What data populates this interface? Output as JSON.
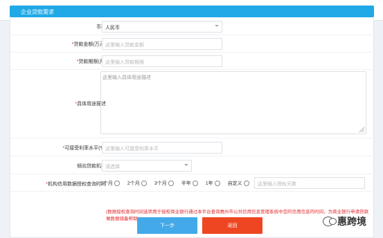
{
  "header": {
    "title": "企业贷款需求"
  },
  "form": {
    "currency": {
      "label": "币种",
      "value": "人民币"
    },
    "amount": {
      "required": "*",
      "label": "贷款金额(万元)",
      "placeholder": "这里输入贷款金额"
    },
    "term": {
      "required": "*",
      "label": "贷款期限(月)",
      "placeholder": "这里输入贷款期限"
    },
    "purpose": {
      "required": "*",
      "label": "具体用途描述",
      "placeholder": "这里输入具体用途描述"
    },
    "rate": {
      "required": "*",
      "label": "可接受利率水平(%)",
      "placeholder": "这里输入可接受利率水平"
    },
    "institution": {
      "label": "倾向贷款机构",
      "placeholder": "请选择"
    },
    "query_time": {
      "required": "*",
      "label": "机构信用数据授权查询时间",
      "options": [
        "1个月",
        "2个月",
        "3个月",
        "半年",
        "1年",
        "自定义"
      ],
      "custom_placeholder": "这里输入授权天数"
    }
  },
  "note": "(数据授权查询时间选项用于授权商业银行通过本平台查询惠州市公共信用信息管理系统中您的信用信息的时间，为商业银行申请贷款做数据储备帮助)",
  "buttons": {
    "next": "下一步",
    "back": "返回"
  },
  "watermark": {
    "text": "惠跨境"
  }
}
